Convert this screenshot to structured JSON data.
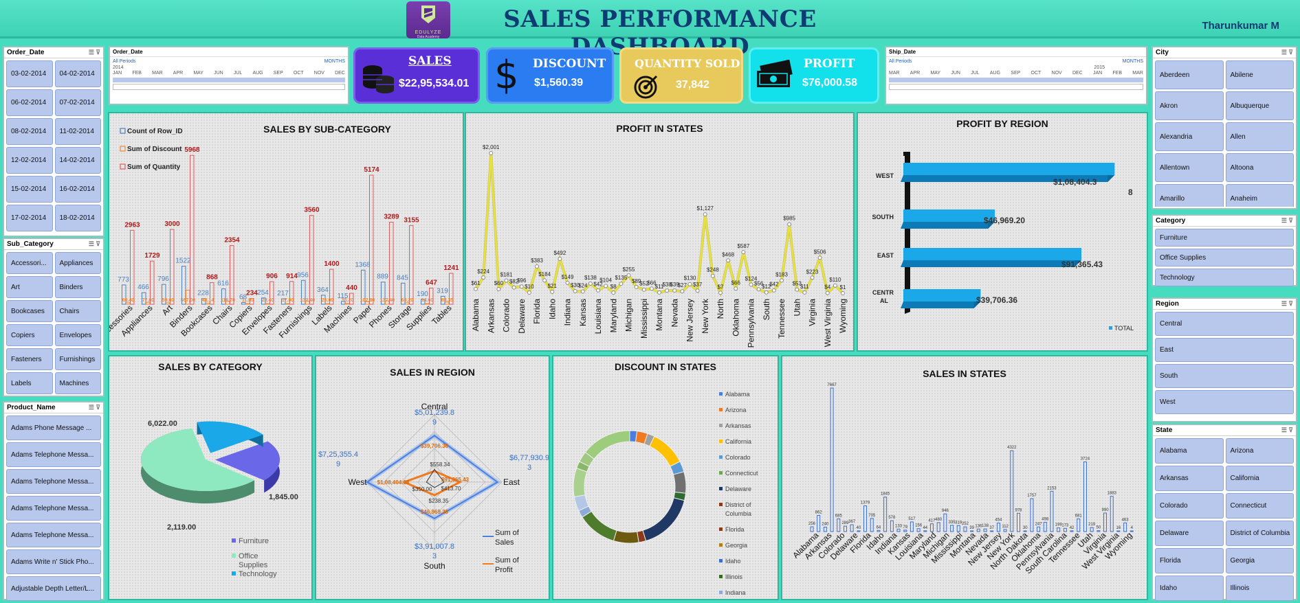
{
  "header": {
    "title": "SALES PERFORMANCE DASHBOARD",
    "author": "Tharunkumar M",
    "logo_text": "EDULYZE",
    "logo_sub": "Data Academy"
  },
  "slicers": {
    "order_date": {
      "title": "Order_Date",
      "items": [
        "03-02-2014",
        "04-02-2014",
        "06-02-2014",
        "07-02-2014",
        "08-02-2014",
        "11-02-2014",
        "12-02-2014",
        "14-02-2014",
        "15-02-2014",
        "16-02-2014",
        "17-02-2014",
        "18-02-2014"
      ]
    },
    "sub_category": {
      "title": "Sub_Category",
      "items": [
        "Accessori...",
        "Appliances",
        "Art",
        "Binders",
        "Bookcases",
        "Chairs",
        "Copiers",
        "Envelopes",
        "Fasteners",
        "Furnishings",
        "Labels",
        "Machines"
      ]
    },
    "product_name": {
      "title": "Product_Name",
      "items": [
        "Adams Phone Message ...",
        "Adams Telephone Messa...",
        "Adams Telephone Messa...",
        "Adams Telephone Messa...",
        "Adams Telephone Messa...",
        "Adams Write n' Stick Pho...",
        "Adjustable Depth Letter/L..."
      ]
    },
    "city": {
      "title": "City",
      "items": [
        "Aberdeen",
        "Abilene",
        "Akron",
        "Albuquerque",
        "Alexandria",
        "Allen",
        "Allentown",
        "Altoona",
        "Amarillo",
        "Anaheim"
      ]
    },
    "category": {
      "title": "Category",
      "items": [
        "Furniture",
        "Office Supplies",
        "Technology"
      ]
    },
    "region": {
      "title": "Region",
      "items": [
        "Central",
        "East",
        "South",
        "West"
      ]
    },
    "state": {
      "title": "State",
      "items": [
        "Alabama",
        "Arizona",
        "Arkansas",
        "California",
        "Colorado",
        "Connecticut",
        "Delaware",
        "District of Columbia",
        "Florida",
        "Georgia",
        "Idaho",
        "Illinois"
      ]
    }
  },
  "timelines": {
    "order": {
      "title": "Order_Date",
      "period": "All Periods",
      "unit": "MONTHS",
      "year": "2014",
      "months": [
        "JAN",
        "FEB",
        "MAR",
        "APR",
        "MAY",
        "JUN",
        "JUL",
        "AUG",
        "SEP",
        "OCT",
        "NOV",
        "DEC"
      ]
    },
    "ship": {
      "title": "Ship_Date",
      "period": "All Periods",
      "unit": "MONTHS",
      "year": "2015",
      "months": [
        "MAR",
        "APR",
        "MAY",
        "JUN",
        "JUL",
        "AUG",
        "SEP",
        "OCT",
        "NOV",
        "DEC",
        "JAN",
        "FEB",
        "MAR"
      ]
    }
  },
  "kpis": {
    "sales": {
      "label": "SALES",
      "value": "$22,95,534.01",
      "color": "#5b2fd8"
    },
    "discount": {
      "label": "DISCOUNT",
      "value": "$1,560.39",
      "color": "#2a7cf0"
    },
    "quantity": {
      "label": "QUANTITY SOLD",
      "value": "37,842",
      "color": "#e8c95c"
    },
    "profit": {
      "label": "PROFIT",
      "value": "$76,000.58",
      "color": "#12e0ea"
    }
  },
  "chart_data": [
    {
      "id": "sales_by_subcategory",
      "type": "bar",
      "title": "SALES  BY SUB-CATEGORY",
      "categories": [
        "Accessories",
        "Appliances",
        "Art",
        "Binders",
        "Bookcases",
        "Chairs",
        "Copiers",
        "Envelopes",
        "Fasteners",
        "Furnishings",
        "Labels",
        "Machines",
        "Paper",
        "Phones",
        "Storage",
        "Supplies",
        "Tables"
      ],
      "series": [
        {
          "name": "Count of Row_ID",
          "color": "#4a7fc1",
          "values": [
            773,
            466,
            796,
            1522,
            228,
            616,
            68,
            254,
            217,
            956,
            364,
            115,
            1368,
            889,
            845,
            190,
            319
          ]
        },
        {
          "name": "Sum of Discount",
          "color": "#f08a3c",
          "values": [
            60.4,
            77.6,
            59.6,
            567.0,
            48.14,
            116.7,
            11.0,
            20.4,
            17.8,
            132.4,
            25.0,
            35.2,
            102.8,
            137.4,
            63.2,
            14.6,
            83.35
          ]
        },
        {
          "name": "Sum of Quantity",
          "color": "#e05a5a",
          "values": [
            2963,
            1729,
            3000,
            5968,
            868,
            2354,
            234,
            906,
            914,
            3560,
            1400,
            440,
            5174,
            3289,
            3155,
            647,
            1241
          ]
        }
      ],
      "value_labels": {
        "count": [
          "773",
          "466",
          "796",
          "1522",
          "228",
          "616",
          "68",
          "254",
          "217",
          "956",
          "364",
          "115",
          "1368",
          "889",
          "845",
          "190",
          "319"
        ],
        "discount": [
          "60.40",
          "77.60",
          "59.60",
          "567.00",
          "48.14",
          "116.70",
          "11.00",
          "20.40",
          "17.80",
          "132.40",
          "25.00",
          "35.20",
          "102.80",
          "137.40",
          "63.20",
          "14.60",
          "83.35"
        ],
        "quantity": [
          "2963",
          "1729",
          "3000",
          "5968",
          "868",
          "2354",
          "234",
          "906",
          "914",
          "3560",
          "1400",
          "440",
          "5174",
          "3289",
          "3155",
          "647",
          "1241"
        ]
      },
      "legend": "top-left"
    },
    {
      "id": "profit_in_states",
      "type": "line",
      "title": "PROFIT IN STATES",
      "tick_labels": [
        "Alabama",
        "Arkansas",
        "Colorado",
        "Delaware",
        "Florida",
        "Idaho",
        "Indiana",
        "Kansas",
        "Louisiana",
        "Maryland",
        "Michigan",
        "Mississippi",
        "Montana",
        "Nevada",
        "New Jersey",
        "New York",
        "North",
        "Oklahoma",
        "Pennsylvania",
        "South",
        "Tennessee",
        "Utah",
        "Virginia",
        "West Virginia",
        "Wyoming"
      ],
      "values": [
        61,
        224,
        2001,
        60,
        181,
        82,
        96,
        10,
        383,
        184,
        21,
        492,
        149,
        30,
        24,
        138,
        42,
        104,
        8,
        135,
        255,
        89,
        52,
        66,
        11,
        38,
        39,
        27,
        130,
        37,
        1127,
        248,
        7,
        468,
        66,
        587,
        124,
        56,
        12,
        42,
        183,
        985,
        53,
        11,
        223,
        506,
        4,
        110,
        1
      ],
      "labels": [
        "$61",
        "$224",
        "$2,001",
        "$60",
        "$181",
        "$82",
        "$96",
        "$10",
        "$383",
        "$184",
        "$21",
        "$492",
        "$149",
        "$30",
        "$24",
        "$138",
        "$42",
        "$104",
        "$8",
        "$135",
        "$255",
        "$89",
        "$52",
        "$66",
        "$11",
        "$38",
        "$39",
        "$27",
        "$130",
        "$37",
        "$1,127",
        "$248",
        "$7",
        "$468",
        "$66",
        "$587",
        "$124",
        "$56",
        "$12",
        "$42",
        "$183",
        "$985",
        "$53",
        "$11",
        "$223",
        "$506",
        "$4",
        "$110",
        "$1"
      ],
      "color": "#e8e23a"
    },
    {
      "id": "profit_by_region",
      "type": "bar",
      "orientation": "horizontal",
      "title": "PROFIT BY REGION",
      "categories": [
        "WEST",
        "SOUTH",
        "EAST",
        "CENTRAL"
      ],
      "category_labels": [
        "WEST",
        "SOUTH",
        "EAST",
        "CENTR",
        "AL"
      ],
      "values": [
        108404.38,
        46969.2,
        91365.43,
        39706.36
      ],
      "labels": [
        "$1,08,404.3",
        "8",
        "$46,969.20",
        "$91,365.43",
        "$39,706.36"
      ],
      "legend": "TOTAL",
      "color": "#1ba8e8"
    },
    {
      "id": "sales_by_category",
      "type": "pie",
      "title": "SALES BY CATEGORY",
      "categories": [
        "Furniture",
        "Office Supplies",
        "Technology"
      ],
      "legend_lines": [
        "Furniture",
        "Office",
        "Supplies",
        "Technology"
      ],
      "values": [
        2119.0,
        6022.0,
        1845.0
      ],
      "labels": [
        "2,119.00",
        "6,022.00",
        "1,845.00"
      ],
      "colors": [
        "#6a68e8",
        "#8ee8c0",
        "#1aa8e8"
      ]
    },
    {
      "id": "sales_in_region",
      "type": "radar",
      "title": "SALES IN REGION",
      "axes": [
        "Central",
        "East",
        "South",
        "West"
      ],
      "series": [
        {
          "name": "Sum of Sales",
          "color": "#4a7fe0",
          "values": [
            501239.89,
            677930.9,
            391007.83,
            725355.49
          ]
        },
        {
          "name": "Sum of Profit",
          "color": "#f07a20",
          "values": [
            39706.36,
            91365.43,
            46969.2,
            108404.38
          ]
        },
        {
          "name": "Sum of Discount",
          "color": "#333333",
          "values": [
            558.34,
            413.7,
            238.35,
            350.0
          ]
        }
      ],
      "label_lines": {
        "sales": [
          [
            "$5,01,239.8",
            "9"
          ],
          [
            "$6,77,930.9",
            "3"
          ],
          [
            "$3,91,007.8",
            "3"
          ],
          [
            "$7,25,355.4",
            "9"
          ]
        ],
        "profit": [
          "$39,706.36",
          "$91,365.43",
          "$46,969.20",
          "$1,08,404.38"
        ],
        "discount": [
          "$558.34",
          "$413.70",
          "$238.35",
          "$350.00"
        ]
      },
      "legend_lines": [
        [
          "Sum of",
          "Sales"
        ],
        [
          "Sum of",
          "Profit"
        ]
      ]
    },
    {
      "id": "discount_in_states",
      "type": "pie",
      "subtype": "doughnut",
      "title": "DISCOUNT IN STATES",
      "legend": [
        "Alabama",
        "Arizona",
        "Arkansas",
        "California",
        "Colorado",
        "Connecticut",
        "Delaware",
        "District of",
        "Columbia",
        "Florida",
        "Georgia",
        "Idaho",
        "Illinois",
        "Indiana"
      ],
      "values": [
        2,
        3,
        2,
        10,
        3,
        6,
        2,
        16,
        2,
        7,
        11,
        2,
        4,
        8,
        2,
        3,
        14
      ],
      "colors": [
        "#4a7fe0",
        "#f07a20",
        "#a0a0a0",
        "#ffc000",
        "#5b9bd5",
        "#707070",
        "#2e6b2e",
        "#203864",
        "#8a3b1c",
        "#6b5a10",
        "#4e7c2c",
        "#8eaadb",
        "#b4c7e7",
        "#a9d18e",
        "#8ab86a",
        "#a0c880",
        "#9ccc7c"
      ]
    },
    {
      "id": "sales_in_states",
      "type": "bar",
      "title": "SALES IN STATES",
      "tick_labels": [
        "Alabama",
        "Arkansas",
        "Colorado",
        "Delaware",
        "Florida",
        "Idaho",
        "Indiana",
        "Kansas",
        "Louisiana",
        "Maryland",
        "Michigan",
        "Mississippi",
        "Montana",
        "Nevada",
        "New Jersey",
        "New York",
        "North Dakota",
        "Oklahoma",
        "Pennsylvania",
        "South Carolina",
        "Tennessee",
        "Utah",
        "Virginia",
        "West Virginia",
        "Wyoming"
      ],
      "values": [
        256,
        862,
        240,
        7667,
        685,
        289,
        367,
        40,
        1379,
        705,
        64,
        1845,
        578,
        133,
        79,
        517,
        156,
        44,
        417,
        480,
        946,
        335,
        319,
        252,
        39,
        136,
        138,
        37,
        454,
        112,
        4322,
        978,
        30,
        1757,
        247,
        498,
        2153,
        199,
        173,
        42,
        681,
        3724,
        219,
        50,
        990,
        1883,
        16,
        463,
        4
      ],
      "color": "#3a6fd0"
    }
  ]
}
